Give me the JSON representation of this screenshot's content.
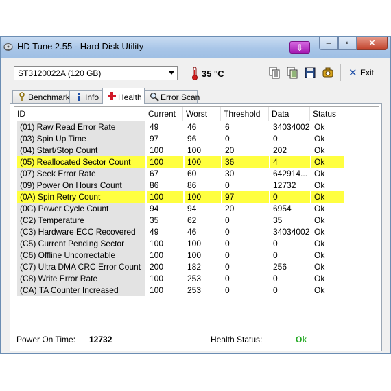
{
  "window": {
    "title": "HD Tune 2.55 - Hard Disk Utility",
    "tray_button_glyph": "⇩",
    "controls": {
      "minimize": "–",
      "maximize": "▫",
      "close": "✕"
    }
  },
  "toolbar": {
    "drive": "ST3120022A (120 GB)",
    "temperature": "35 °C",
    "icons": [
      "copy-icon",
      "copy-all-icon",
      "save-icon",
      "screenshot-icon"
    ],
    "exit_label": "Exit"
  },
  "tabs": [
    {
      "label": "Benchmark",
      "icon": "benchmark-icon",
      "active": false
    },
    {
      "label": "Info",
      "icon": "info-icon",
      "active": false
    },
    {
      "label": "Health",
      "icon": "health-cross-icon",
      "active": true
    },
    {
      "label": "Error Scan",
      "icon": "magnifier-icon",
      "active": false
    }
  ],
  "health_table": {
    "columns": [
      "ID",
      "Current",
      "Worst",
      "Threshold",
      "Data",
      "Status"
    ],
    "rows": [
      {
        "id": "(01) Raw Read Error Rate",
        "current": "49",
        "worst": "46",
        "threshold": "6",
        "data": "34034002",
        "status": "Ok",
        "highlight": false
      },
      {
        "id": "(03) Spin Up Time",
        "current": "97",
        "worst": "96",
        "threshold": "0",
        "data": "0",
        "status": "Ok",
        "highlight": false
      },
      {
        "id": "(04) Start/Stop Count",
        "current": "100",
        "worst": "100",
        "threshold": "20",
        "data": "202",
        "status": "Ok",
        "highlight": false
      },
      {
        "id": "(05) Reallocated Sector Count",
        "current": "100",
        "worst": "100",
        "threshold": "36",
        "data": "4",
        "status": "Ok",
        "highlight": true
      },
      {
        "id": "(07) Seek Error Rate",
        "current": "67",
        "worst": "60",
        "threshold": "30",
        "data": "642914...",
        "status": "Ok",
        "highlight": false
      },
      {
        "id": "(09) Power On Hours Count",
        "current": "86",
        "worst": "86",
        "threshold": "0",
        "data": "12732",
        "status": "Ok",
        "highlight": false
      },
      {
        "id": "(0A) Spin Retry Count",
        "current": "100",
        "worst": "100",
        "threshold": "97",
        "data": "0",
        "status": "Ok",
        "highlight": true
      },
      {
        "id": "(0C) Power Cycle Count",
        "current": "94",
        "worst": "94",
        "threshold": "20",
        "data": "6954",
        "status": "Ok",
        "highlight": false
      },
      {
        "id": "(C2) Temperature",
        "current": "35",
        "worst": "62",
        "threshold": "0",
        "data": "35",
        "status": "Ok",
        "highlight": false
      },
      {
        "id": "(C3) Hardware ECC Recovered",
        "current": "49",
        "worst": "46",
        "threshold": "0",
        "data": "34034002",
        "status": "Ok",
        "highlight": false
      },
      {
        "id": "(C5) Current Pending Sector",
        "current": "100",
        "worst": "100",
        "threshold": "0",
        "data": "0",
        "status": "Ok",
        "highlight": false
      },
      {
        "id": "(C6) Offline Uncorrectable",
        "current": "100",
        "worst": "100",
        "threshold": "0",
        "data": "0",
        "status": "Ok",
        "highlight": false
      },
      {
        "id": "(C7) Ultra DMA CRC Error Count",
        "current": "200",
        "worst": "182",
        "threshold": "0",
        "data": "256",
        "status": "Ok",
        "highlight": false
      },
      {
        "id": "(C8) Write Error Rate",
        "current": "100",
        "worst": "253",
        "threshold": "0",
        "data": "0",
        "status": "Ok",
        "highlight": false
      },
      {
        "id": "(CA) TA Counter Increased",
        "current": "100",
        "worst": "253",
        "threshold": "0",
        "data": "0",
        "status": "Ok",
        "highlight": false
      }
    ]
  },
  "status_bar": {
    "power_on_label": "Power On Time:",
    "power_on_value": "12732",
    "health_label": "Health Status:",
    "health_value": "Ok"
  },
  "colors": {
    "highlight_row": "#ffff40",
    "health_ok": "#22a822",
    "tray_button": "#a51bb3",
    "close_button": "#c1422b"
  }
}
